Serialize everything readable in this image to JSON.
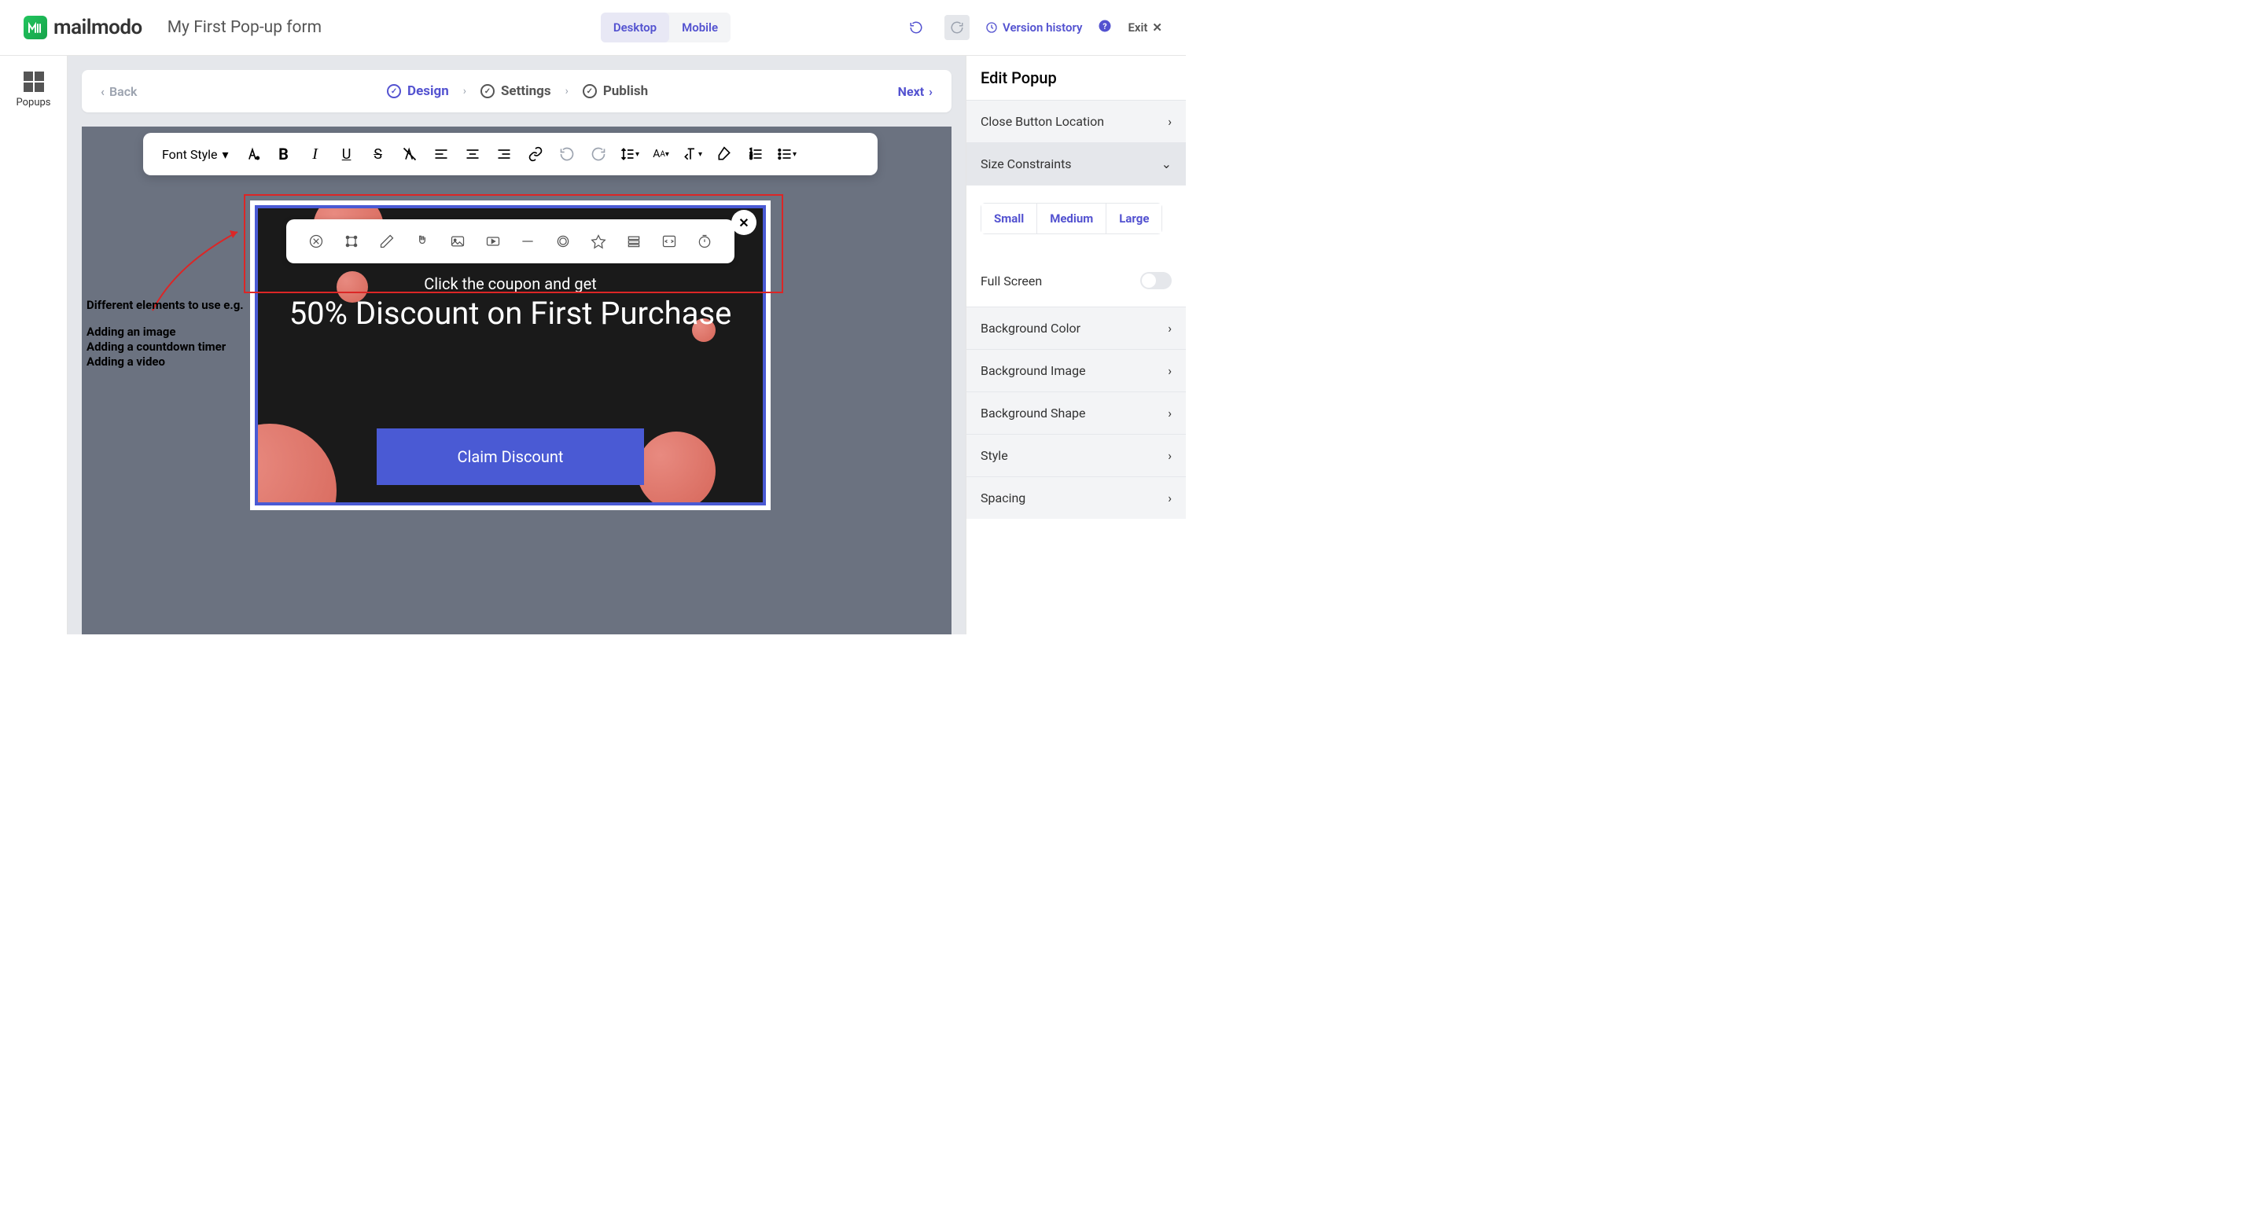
{
  "header": {
    "logo_text": "mailmodo",
    "doc_title": "My First Pop-up form",
    "device": {
      "desktop": "Desktop",
      "mobile": "Mobile"
    },
    "version_history": "Version history",
    "exit": "Exit"
  },
  "left_rail": {
    "popups": "Popups"
  },
  "progress": {
    "back": "Back",
    "steps": [
      "Design",
      "Settings",
      "Publish"
    ],
    "next": "Next"
  },
  "text_toolbar": {
    "font_style": "Font Style"
  },
  "popup": {
    "subtitle": "Click the coupon and get",
    "title": "50% Discount on First Purchase",
    "cta": "Claim Discount"
  },
  "annotations": {
    "heading": "Different elements to use e.g.",
    "items": [
      "Adding an image",
      "Adding a countdown timer",
      "Adding a video"
    ]
  },
  "right_panel": {
    "title": "Edit Popup",
    "close_button_location": "Close Button Location",
    "size_constraints": "Size Constraints",
    "sizes": [
      "Small",
      "Medium",
      "Large"
    ],
    "full_screen": "Full Screen",
    "background_color": "Background Color",
    "background_image": "Background Image",
    "background_shape": "Background Shape",
    "style": "Style",
    "spacing": "Spacing"
  }
}
